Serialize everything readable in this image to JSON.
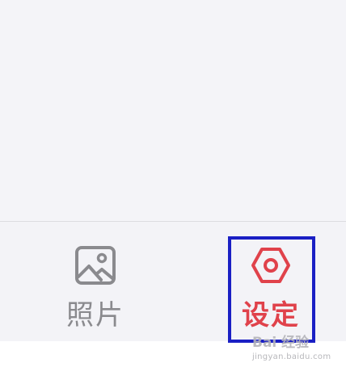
{
  "tabbar": {
    "tabs": [
      {
        "label": "照片",
        "icon": "photo-icon",
        "color": "#8a8a8e",
        "selected": false
      },
      {
        "label": "设定",
        "icon": "settings-hexagon-icon",
        "color": "#e0424b",
        "selected": true
      }
    ]
  },
  "watermark": {
    "brand": "Bai 经验",
    "url": "jingyan.baidu.com"
  },
  "colors": {
    "highlight": "#1a1fc4",
    "background": "#f3f3f7"
  }
}
